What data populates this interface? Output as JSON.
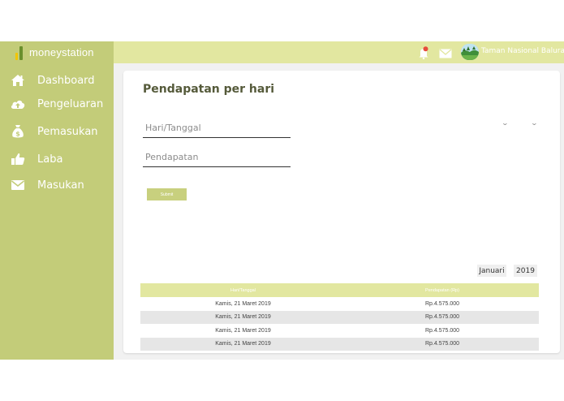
{
  "brand": {
    "name": "moneystation"
  },
  "sidebar": {
    "items": [
      {
        "label": "Dashboard",
        "icon": "home-icon"
      },
      {
        "label": "Pengeluaran",
        "icon": "cloud-upload-icon"
      },
      {
        "label": "Pemasukan",
        "icon": "money-bag-icon"
      },
      {
        "label": "Laba",
        "icon": "thumbs-up-icon"
      },
      {
        "label": "Masukan",
        "icon": "envelope-icon"
      }
    ]
  },
  "topbar": {
    "user_name": "Taman Nasional Baluran"
  },
  "main": {
    "title": "Pendapatan per hari",
    "date_field": {
      "placeholder": "Hari/Tanggal"
    },
    "income_field": {
      "placeholder": "Pendapatan"
    },
    "submit_label": "Submit",
    "filter": {
      "month": "Januari",
      "year": "2019"
    },
    "table": {
      "headers": [
        "Hari/Tanggal",
        "Pendapatan (Rp)"
      ],
      "rows": [
        [
          "Kamis, 21 Maret 2019",
          "Rp.4.575.000"
        ],
        [
          "Kamis, 21 Maret 2019",
          "Rp.4.575.000"
        ],
        [
          "Kamis, 21 Maret 2019",
          "Rp.4.575.000"
        ],
        [
          "Kamis, 21 Maret 2019",
          "Rp.4.575.000"
        ]
      ]
    }
  },
  "colors": {
    "sidebar": "#c3cc79",
    "topbar": "#e2e7a0",
    "table_header": "#e2e7a0",
    "button": "#c8d07e",
    "logo_yellow": "#f2c500",
    "logo_green": "#6a8f2c",
    "notification_dot": "#e74c3c"
  }
}
